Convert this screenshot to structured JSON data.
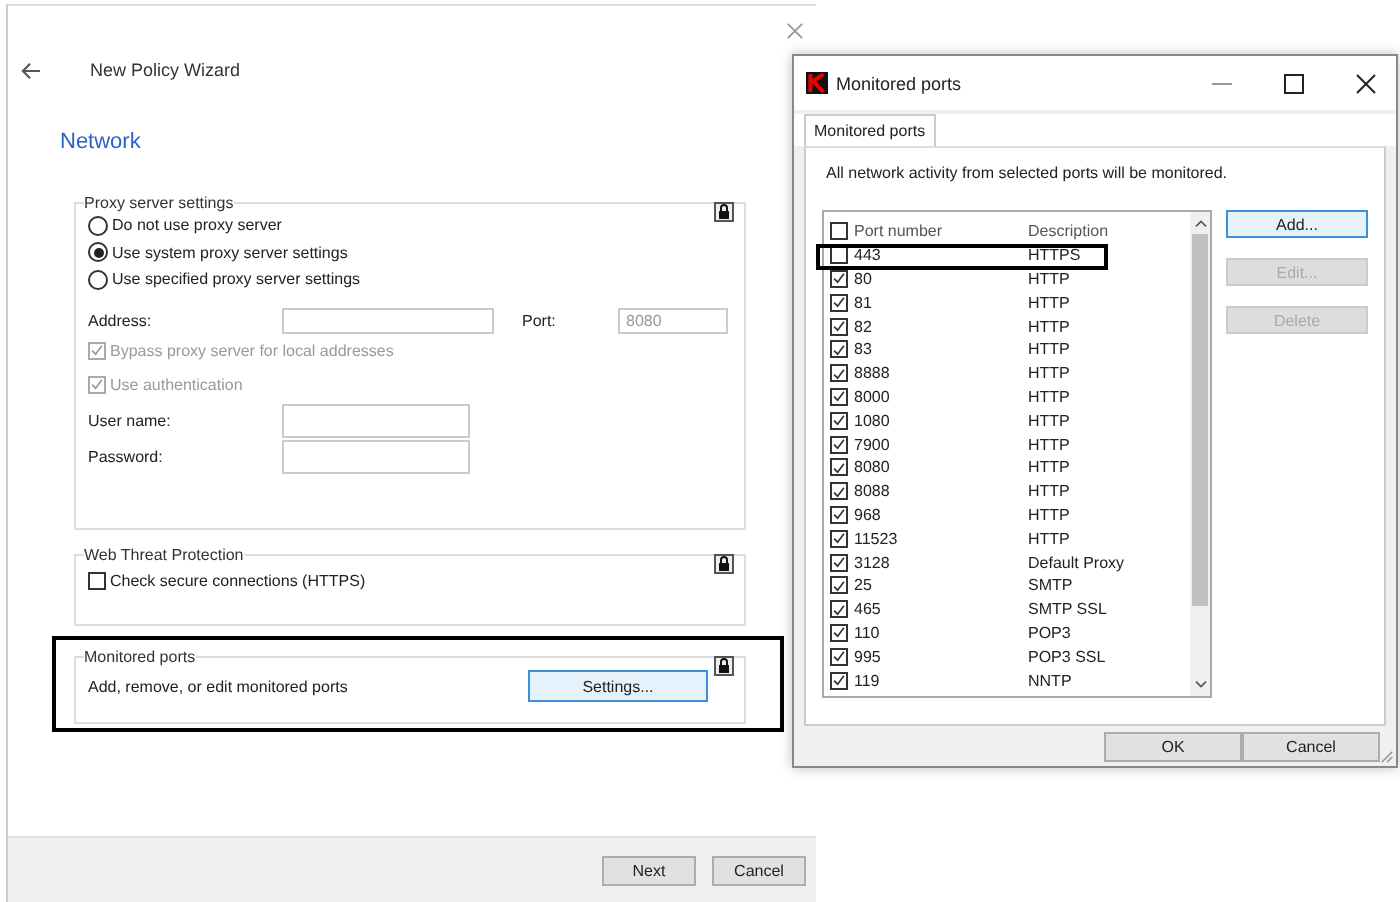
{
  "wizard": {
    "title": "New Policy Wizard",
    "heading": "Network",
    "proxy": {
      "title": "Proxy server settings",
      "options": [
        {
          "label": "Do not use proxy server",
          "selected": false
        },
        {
          "label": "Use system proxy server settings",
          "selected": true
        },
        {
          "label": "Use specified proxy server settings",
          "selected": false
        }
      ],
      "address_label": "Address:",
      "port_label": "Port:",
      "port_value": "8080",
      "checks": [
        {
          "label": "Bypass proxy server for local addresses",
          "checked": true,
          "disabled": true
        },
        {
          "label": "Use authentication",
          "checked": true,
          "disabled": true
        }
      ],
      "username_label": "User name:",
      "password_label": "Password:"
    },
    "web_threat": {
      "title": "Web Threat Protection",
      "check": {
        "label": "Check secure connections (HTTPS)",
        "checked": false
      }
    },
    "monitored": {
      "title": "Monitored ports",
      "text": "Add, remove, or edit monitored ports",
      "button": "Settings..."
    },
    "buttons": [
      "Next",
      "Cancel"
    ]
  },
  "dialog": {
    "title": "Monitored ports",
    "tabs": [
      {
        "label": "Monitored ports",
        "selected": true
      }
    ],
    "description": "All network activity from selected ports will be monitored.",
    "columns": [
      "Port number",
      "Description"
    ],
    "header_checked": false,
    "rows": [
      {
        "port": "443",
        "description": "HTTPS",
        "checked": false
      },
      {
        "port": "80",
        "description": "HTTP",
        "checked": true
      },
      {
        "port": "81",
        "description": "HTTP",
        "checked": true
      },
      {
        "port": "82",
        "description": "HTTP",
        "checked": true
      },
      {
        "port": "83",
        "description": "HTTP",
        "checked": true
      },
      {
        "port": "8888",
        "description": "HTTP",
        "checked": true
      },
      {
        "port": "8000",
        "description": "HTTP",
        "checked": true
      },
      {
        "port": "1080",
        "description": "HTTP",
        "checked": true
      },
      {
        "port": "7900",
        "description": "HTTP",
        "checked": true
      },
      {
        "port": "8080",
        "description": "HTTP",
        "checked": true
      },
      {
        "port": "8088",
        "description": "HTTP",
        "checked": true
      },
      {
        "port": "968",
        "description": "HTTP",
        "checked": true
      },
      {
        "port": "11523",
        "description": "HTTP",
        "checked": true
      },
      {
        "port": "3128",
        "description": "Default Proxy",
        "checked": true
      },
      {
        "port": "25",
        "description": "SMTP",
        "checked": true
      },
      {
        "port": "465",
        "description": "SMTP SSL",
        "checked": true
      },
      {
        "port": "110",
        "description": "POP3",
        "checked": true
      },
      {
        "port": "995",
        "description": "POP3 SSL",
        "checked": true
      },
      {
        "port": "119",
        "description": "NNTP",
        "checked": true
      }
    ],
    "side_buttons": [
      {
        "label": "Add...",
        "disabled": false
      },
      {
        "label": "Edit...",
        "disabled": true
      },
      {
        "label": "Delete",
        "disabled": true
      }
    ],
    "buttons": [
      "OK",
      "Cancel"
    ]
  }
}
